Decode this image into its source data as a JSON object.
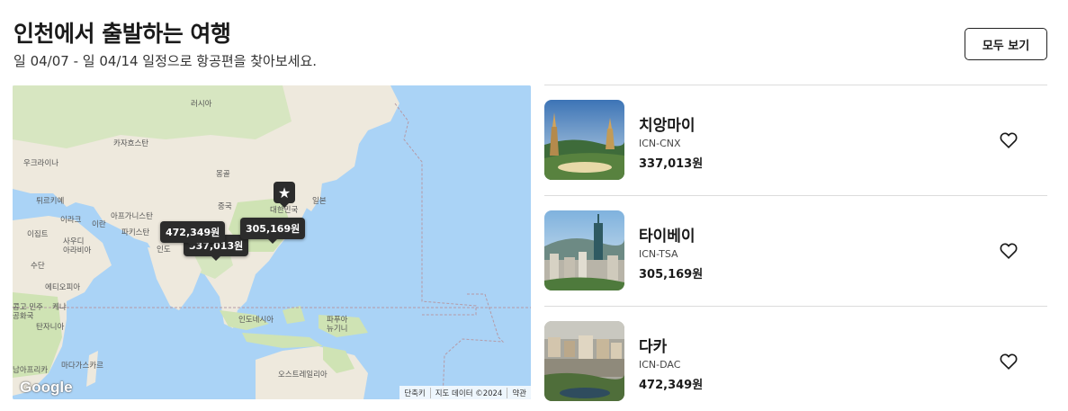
{
  "header": {
    "title": "인천에서 출발하는 여행",
    "subtitle": "일 04/07 - 일 04/14 일정으로 항공편을 찾아보세요.",
    "see_all_label": "모두 보기"
  },
  "map": {
    "labels": {
      "russia": "러시아",
      "ukraine": "우크라이나",
      "kazakhstan": "카자흐스탄",
      "mongolia": "몽골",
      "turkey": "튀르키예",
      "china": "중국",
      "japan": "일본",
      "south_korea": "대한민국",
      "iraq": "이라크",
      "iran": "이란",
      "afghanistan": "아프가니스탄",
      "pakistan": "파키스탄",
      "egypt": "이집트",
      "saudi": "사우디\n아라비아",
      "india": "인도",
      "sudan": "수단",
      "ethiopia": "에티오피아",
      "kenya": "케냐",
      "drc": "콩고 민주\n공화국",
      "tanzania": "탄자니아",
      "indonesia": "인도네시아",
      "png": "파푸아\n뉴기니",
      "madagascar": "마다가스카르",
      "australia": "오스트레일리아",
      "south_africa": "남아프리카"
    },
    "prices": {
      "dhaka": "472,349원",
      "chiang_mai": "337,013원",
      "taipei": "305,169원"
    },
    "origin_icon": "star-icon",
    "google_logo": "Google",
    "attribution": {
      "shortcuts": "단축키",
      "map_data": "지도 데이터 ©2024",
      "terms": "약관"
    },
    "colors": {
      "water": "#aad3f6",
      "land": "#eee9dd",
      "green": "#cfe3b4"
    }
  },
  "destinations": [
    {
      "name": "치앙마이",
      "route": "ICN-CNX",
      "price": "337,013원",
      "icon": "heart-icon"
    },
    {
      "name": "타이베이",
      "route": "ICN-TSA",
      "price": "305,169원",
      "icon": "heart-icon"
    },
    {
      "name": "다카",
      "route": "ICN-DAC",
      "price": "472,349원",
      "icon": "heart-icon"
    }
  ]
}
